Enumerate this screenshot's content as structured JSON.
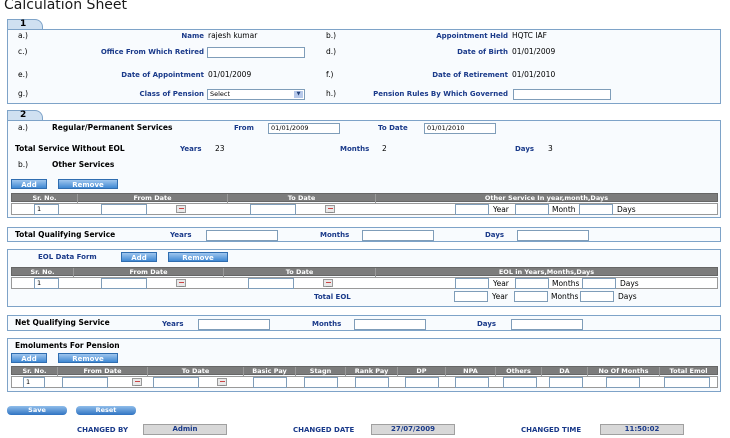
{
  "page_title": "Calculation Sheet",
  "section1": {
    "number": "1",
    "rows": [
      {
        "left_idx": "a.)",
        "left_label": "Name",
        "left_value": "rajesh kumar",
        "right_idx": "b.)",
        "right_label": "Appointment Held",
        "right_value": "HQTC IAF"
      },
      {
        "left_idx": "c.)",
        "left_label": "Office From Which Retired",
        "left_value": "",
        "right_idx": "d.)",
        "right_label": "Date of Birth",
        "right_value": "01/01/2009"
      },
      {
        "left_idx": "e.)",
        "left_label": "Date of Appointment",
        "left_value": "01/01/2009",
        "right_idx": "f.)",
        "right_label": "Date of Retirement",
        "right_value": "01/01/2010"
      },
      {
        "left_idx": "g.)",
        "left_label": "Class of Pension",
        "left_value": "Select",
        "right_idx": "h.)",
        "right_label": "Pension Rules By Which Governed",
        "right_value": ""
      }
    ]
  },
  "section2": {
    "number": "2",
    "regular": {
      "idx": "a.)",
      "label": "Regular/Permanent Services",
      "from_label": "From",
      "from_value": "01/01/2009",
      "to_label": "To Date",
      "to_value": "01/01/2010"
    },
    "without_eol": {
      "label": "Total Service Without EOL",
      "years_label": "Years",
      "years_value": "23",
      "months_label": "Months",
      "months_value": "2",
      "days_label": "Days",
      "days_value": "3"
    },
    "other": {
      "idx": "b.)",
      "label": "Other Services"
    },
    "add_label": "Add",
    "remove_label": "Remove",
    "grid": {
      "headers": [
        "Sr. No.",
        "From Date",
        "To Date",
        "Other Service In year,month,Days"
      ],
      "row": {
        "sr": "1",
        "year_label": "Year",
        "month_label": "Month",
        "days_label": "Days"
      }
    }
  },
  "total_qualifying": {
    "label": "Total Qualifying Service",
    "years_label": "Years",
    "months_label": "Months",
    "days_label": "Days"
  },
  "eol": {
    "label": "EOL Data Form",
    "add_label": "Add",
    "remove_label": "Remove",
    "headers": [
      "Sr. No.",
      "From Date",
      "To Date",
      "EOL in Years,Months,Days"
    ],
    "row": {
      "sr": "1",
      "year_label": "Year",
      "months_label": "Months",
      "days_label": "Days"
    },
    "total_label": "Total EOL",
    "total_year_label": "Year",
    "total_months_label": "Months",
    "total_days_label": "Days"
  },
  "net_qualifying": {
    "label": "Net Qualifying Service",
    "years_label": "Years",
    "months_label": "Months",
    "days_label": "Days"
  },
  "emoluments": {
    "label": "Emoluments For Pension",
    "add_label": "Add",
    "remove_label": "Remove",
    "headers": [
      "Sr. No.",
      "From Date",
      "To Date",
      "Basic Pay",
      "Stagn",
      "Rank Pay",
      "DP",
      "NPA",
      "Others",
      "DA",
      "No Of Months",
      "Total Emol"
    ],
    "row": {
      "sr": "1"
    }
  },
  "footer": {
    "save_label": "Save",
    "reset_label": "Reset",
    "changed_by_label": "CHANGED BY",
    "changed_by_value": "Admin",
    "changed_date_label": "CHANGED DATE",
    "changed_date_value": "27/07/2009",
    "changed_time_label": "CHANGED TIME",
    "changed_time_value": "11:50:02"
  }
}
